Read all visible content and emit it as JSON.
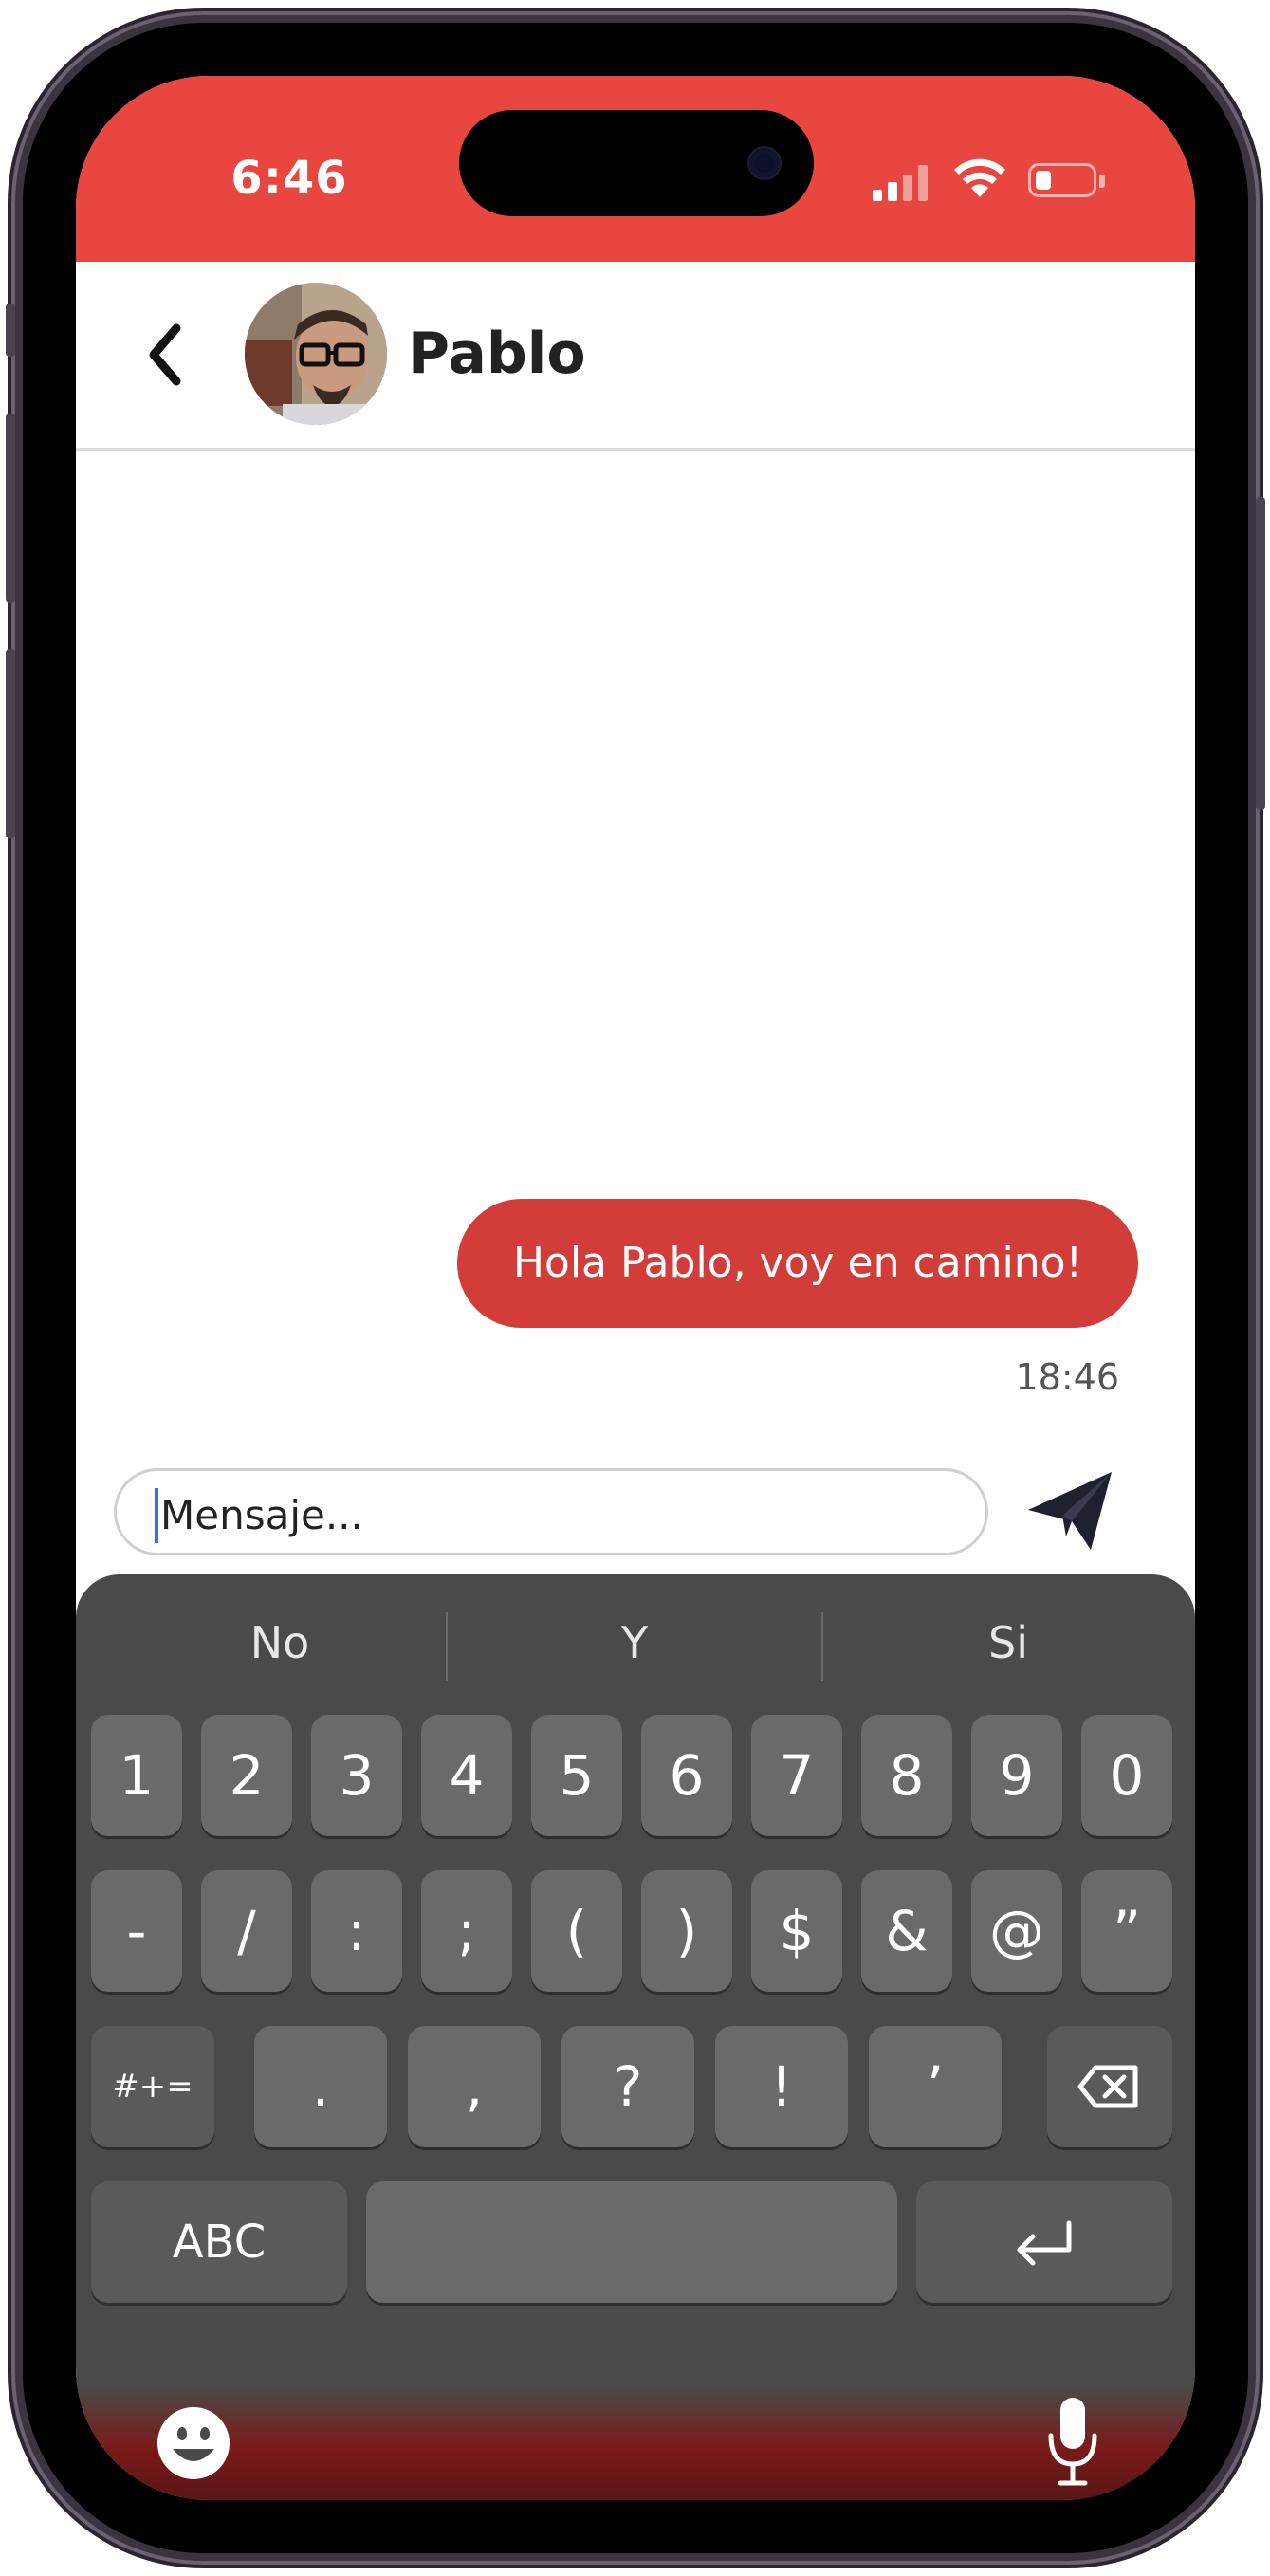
{
  "status_bar": {
    "time": "6:46",
    "accent_color": "#e8463f"
  },
  "chat_header": {
    "contact_name": "Pablo",
    "back_icon": "chevron-left-icon",
    "avatar": "contact-avatar"
  },
  "messages": [
    {
      "direction": "outgoing",
      "text": "Hola Pablo, voy en camino!",
      "time": "18:46",
      "bubble_color": "#d23d3a"
    }
  ],
  "composer": {
    "placeholder": "Mensaje...",
    "value": "",
    "send_icon": "paper-plane-icon"
  },
  "keyboard": {
    "suggestions": [
      "No",
      "Y",
      "Si"
    ],
    "row1": [
      "1",
      "2",
      "3",
      "4",
      "5",
      "6",
      "7",
      "8",
      "9",
      "0"
    ],
    "row2": [
      "-",
      "/",
      ":",
      ";",
      "(",
      ")",
      "$",
      "&",
      "@",
      "”"
    ],
    "row3": [
      ".",
      ",",
      "?",
      "!",
      "’"
    ],
    "mode_key": "#+=",
    "abc_key": "ABC",
    "delete_icon": "backspace-icon",
    "return_icon": "return-icon",
    "emoji_icon": "emoji-icon",
    "mic_icon": "microphone-icon"
  }
}
